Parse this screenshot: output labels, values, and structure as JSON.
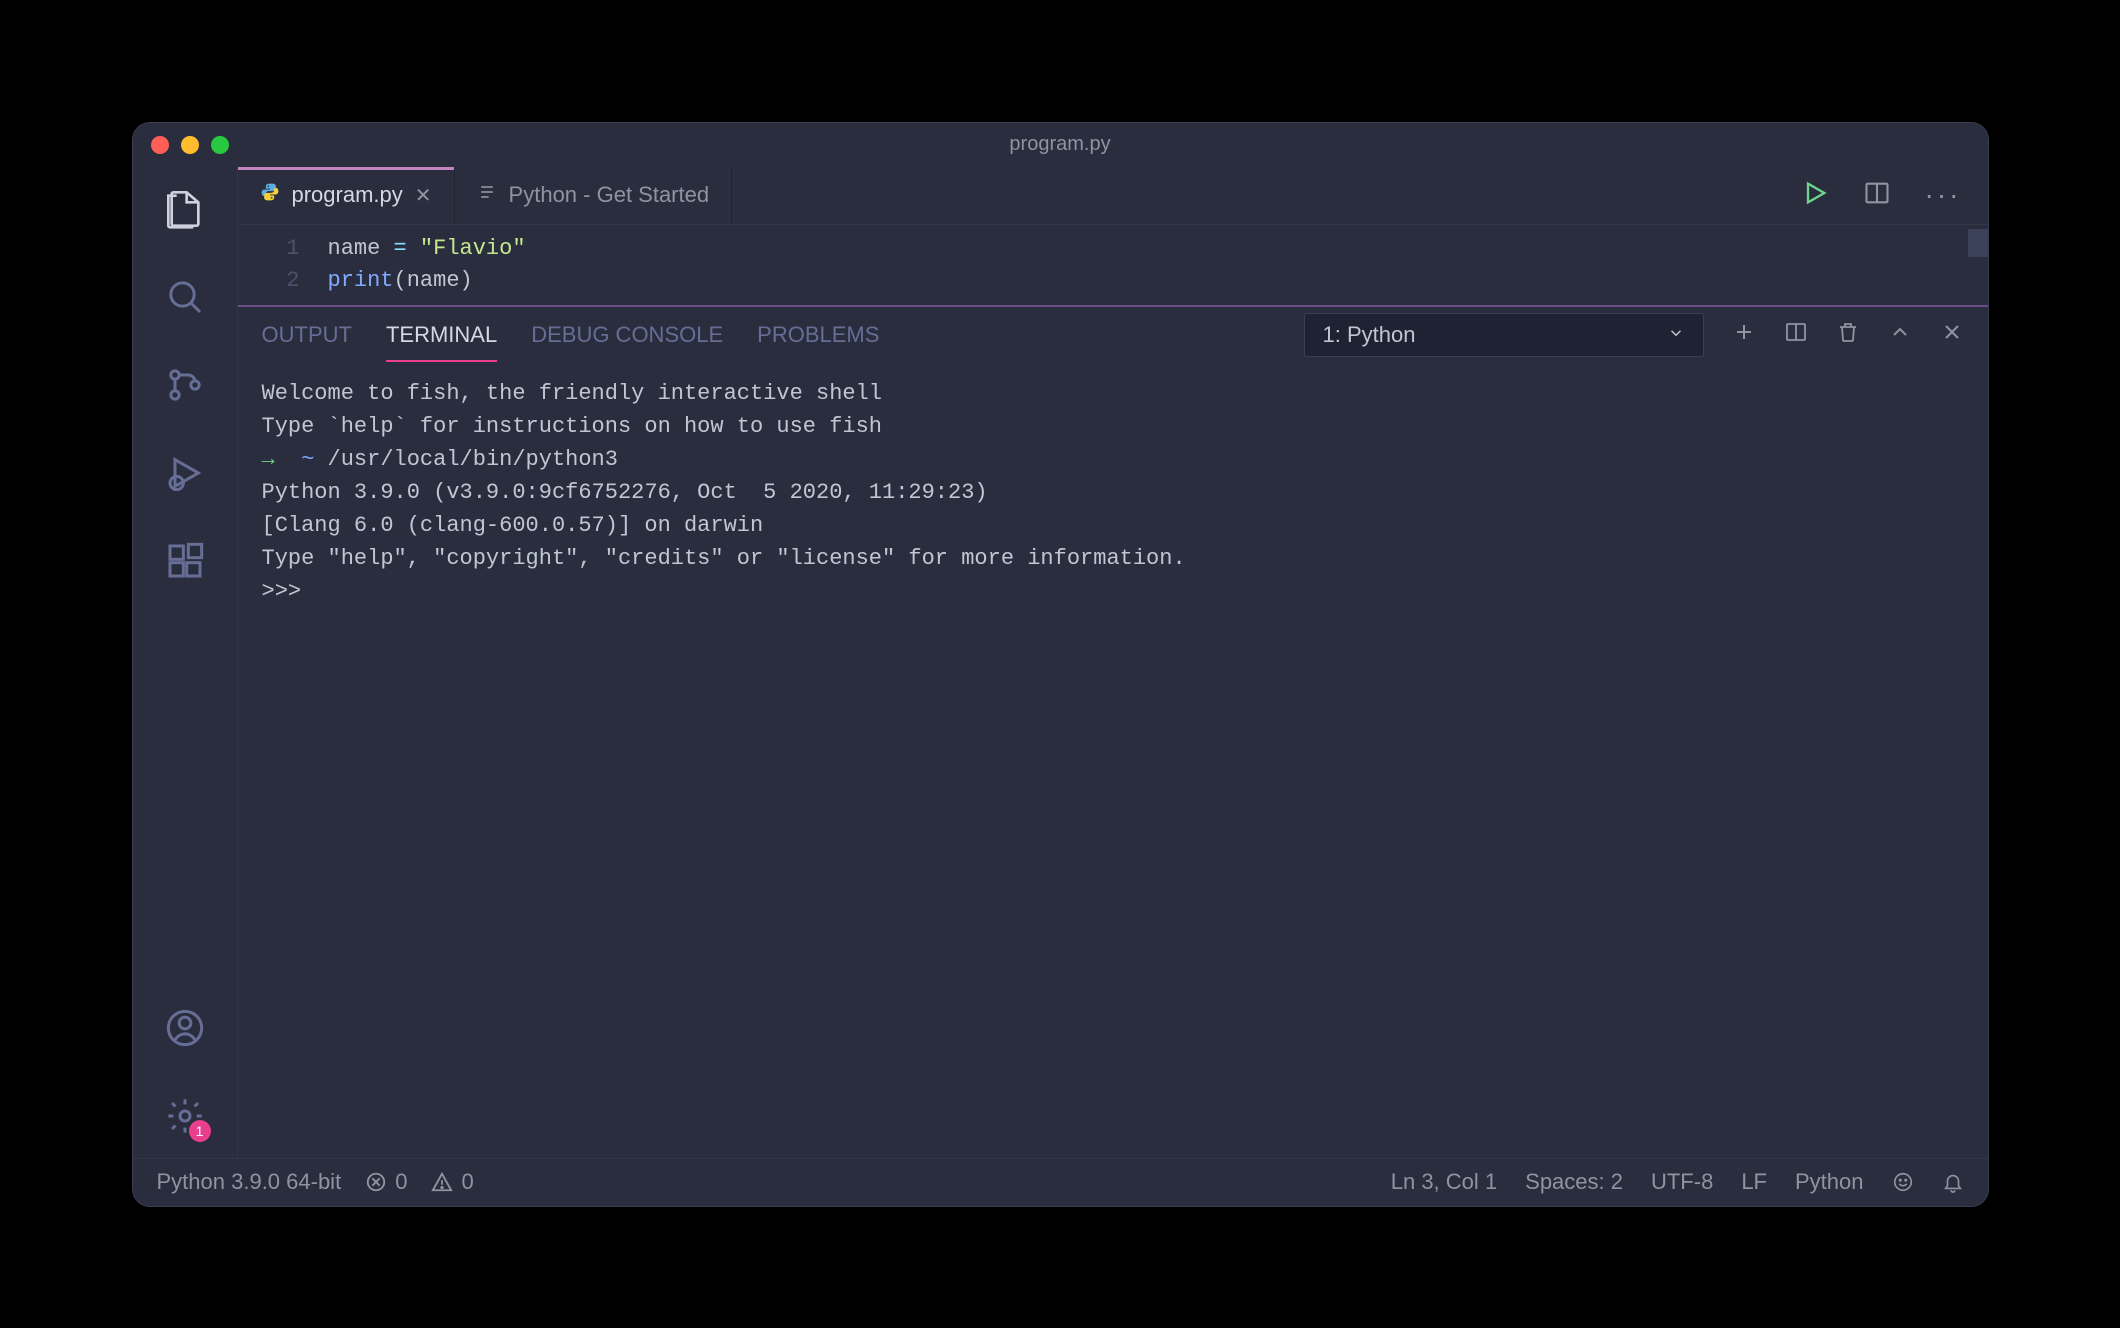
{
  "window": {
    "title": "program.py"
  },
  "tabs": [
    {
      "label": "program.py",
      "active": true,
      "icon": "python"
    },
    {
      "label": "Python - Get Started",
      "active": false,
      "icon": "list"
    }
  ],
  "editor": {
    "lines": [
      {
        "num": "1",
        "tokens": [
          {
            "t": "name ",
            "c": "tok-var"
          },
          {
            "t": "=",
            "c": "tok-op"
          },
          {
            "t": " ",
            "c": "tok-var"
          },
          {
            "t": "\"Flavio\"",
            "c": "tok-str"
          }
        ]
      },
      {
        "num": "2",
        "tokens": [
          {
            "t": "print",
            "c": "tok-fn"
          },
          {
            "t": "(",
            "c": "tok-paren"
          },
          {
            "t": "name",
            "c": "tok-var"
          },
          {
            "t": ")",
            "c": "tok-paren"
          }
        ]
      }
    ]
  },
  "panel": {
    "tabs": [
      "OUTPUT",
      "TERMINAL",
      "DEBUG CONSOLE",
      "PROBLEMS"
    ],
    "active": "TERMINAL",
    "terminal_select": "1: Python"
  },
  "terminal": {
    "line1": "Welcome to fish, the friendly interactive shell",
    "line2": "Type `help` for instructions on how to use fish",
    "prompt_arrow": "→",
    "prompt_tilde": "~",
    "prompt_cmd": "/usr/local/bin/python3",
    "line4": "Python 3.9.0 (v3.9.0:9cf6752276, Oct  5 2020, 11:29:23)",
    "line5": "[Clang 6.0 (clang-600.0.57)] on darwin",
    "line6": "Type \"help\", \"copyright\", \"credits\" or \"license\" for more information.",
    "line7": ">>>"
  },
  "activitybar": {
    "settings_badge": "1"
  },
  "statusbar": {
    "interpreter": "Python 3.9.0 64-bit",
    "errors": "0",
    "warnings": "0",
    "cursor": "Ln 3, Col 1",
    "spaces": "Spaces: 2",
    "encoding": "UTF-8",
    "eol": "LF",
    "lang": "Python"
  }
}
